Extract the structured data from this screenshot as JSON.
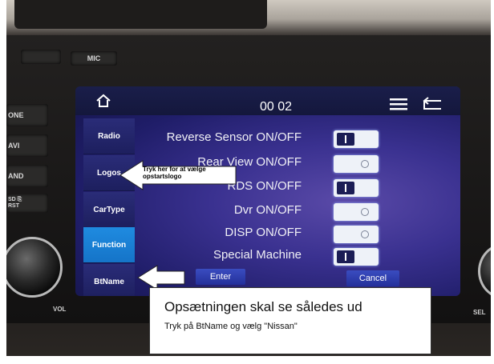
{
  "screen": {
    "time": "00 02",
    "sidebar": [
      {
        "label": "Radio"
      },
      {
        "label": "Logos"
      },
      {
        "label": "CarType"
      },
      {
        "label": "Function"
      },
      {
        "label": "BtName"
      }
    ],
    "active_tab": "Function",
    "settings": [
      {
        "label": "Reverse Sensor ON/OFF",
        "state": "on"
      },
      {
        "label": "Rear View ON/OFF",
        "state": "off"
      },
      {
        "label": "RDS ON/OFF",
        "state": "on"
      },
      {
        "label": "Dvr ON/OFF",
        "state": "off"
      },
      {
        "label": "DISP ON/OFF",
        "state": "off"
      },
      {
        "label": "Special Machine",
        "state": "on"
      }
    ],
    "enter_label": "Enter",
    "cancel_label": "Cancel",
    "icons": [
      "home-icon",
      "menu-icon",
      "back-icon"
    ]
  },
  "hardware": {
    "mic_label": "MIC",
    "left_buttons": [
      "ONE",
      "AVI",
      "AND",
      "SD ⎘\nRST"
    ],
    "vol_label": "VOL",
    "sel_label": "SEL"
  },
  "annotations": {
    "logos_callout": "Tryk her for at vælge opstartslogo",
    "info_title": "Opsætningen skal se således ud",
    "info_subtitle": "Tryk på BtName og vælg \"Nissan\""
  },
  "colors": {
    "screen_bg": "#2a2680",
    "active_tab": "#1f8be0",
    "toggle_bg": "#eef2f8"
  }
}
